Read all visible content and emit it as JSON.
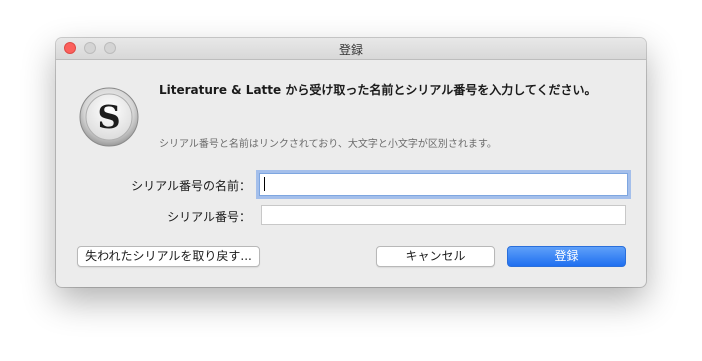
{
  "window": {
    "title": "登録"
  },
  "app_icon": {
    "name": "scrivener-icon",
    "glyph": "S"
  },
  "dialog": {
    "headline": "Literature & Latte から受け取った名前とシリアル番号を入力してください。",
    "subtext": "シリアル番号と名前はリンクされており、大文字と小文字が区別されます。"
  },
  "form": {
    "name_label": "シリアル番号の名前：",
    "name_value": "",
    "serial_label": "シリアル番号：",
    "serial_value": ""
  },
  "buttons": {
    "recover_label": "失われたシリアルを取り戻す...",
    "cancel_label": "キャンセル",
    "register_label": "登録"
  },
  "colors": {
    "close": "#fc605c",
    "primary_button": "#2a7af2",
    "focus_ring": "#699beb"
  }
}
